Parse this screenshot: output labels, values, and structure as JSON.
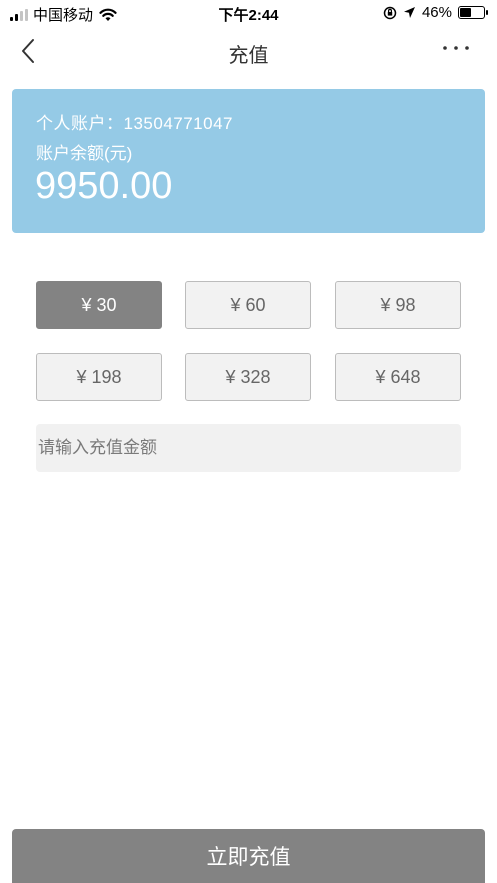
{
  "status_bar": {
    "carrier": "中国移动",
    "time": "下午2:44",
    "battery": "46%",
    "battery_level": 0.46,
    "icons": [
      "signal-icon",
      "wifi-icon",
      "orientation-lock-icon",
      "location-icon",
      "battery-icon"
    ]
  },
  "nav": {
    "title": "充值",
    "back_icon": "chevron-left-icon",
    "more_icon": "more-dots-icon"
  },
  "account": {
    "label": "个人账户：13504771047",
    "balance_label": "账户余额(元)",
    "balance": "9950.00"
  },
  "amounts": [
    {
      "label": "¥ 30",
      "selected": true
    },
    {
      "label": "¥ 60",
      "selected": false
    },
    {
      "label": "¥ 98",
      "selected": false
    },
    {
      "label": "¥ 198",
      "selected": false
    },
    {
      "label": "¥ 328",
      "selected": false
    },
    {
      "label": "¥ 648",
      "selected": false
    }
  ],
  "input": {
    "placeholder": "请输入充值金额",
    "value": ""
  },
  "submit_label": "立即充值",
  "colors": {
    "card": "#95cae6",
    "selected": "#838383",
    "button_bg": "#f2f2f2",
    "submit": "#838383"
  }
}
